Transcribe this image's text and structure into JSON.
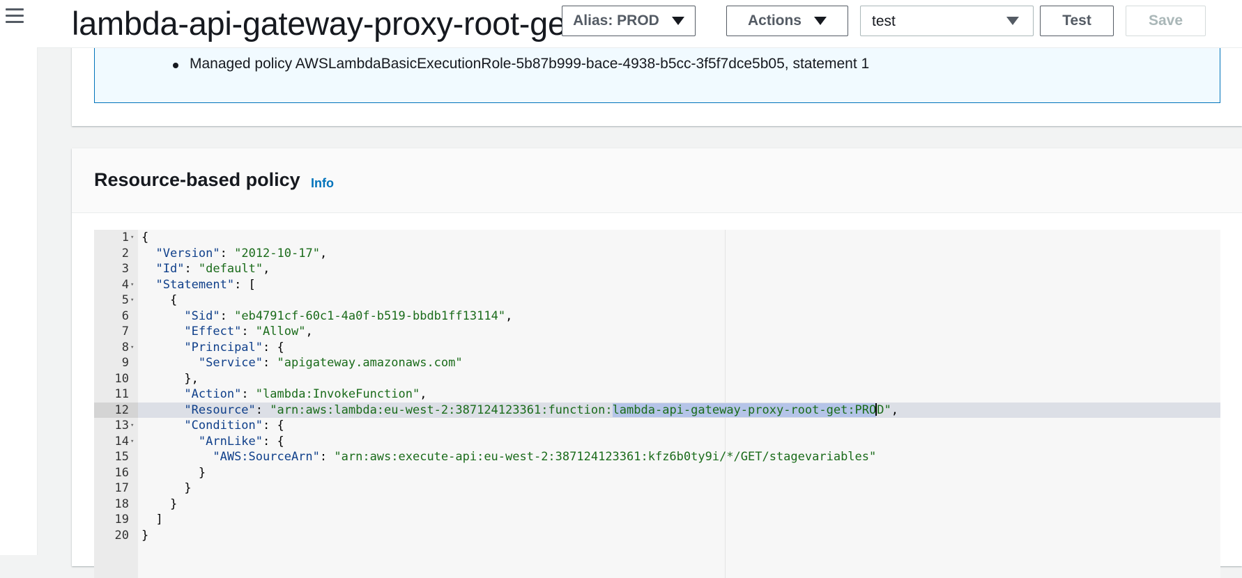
{
  "header": {
    "title": "lambda-api-gateway-proxy-root-get",
    "title_display": "lambda-api-gateway-proxy-root-ge…",
    "alias_button": "Alias: PROD",
    "actions_button": "Actions",
    "test_event_select": "test",
    "test_button": "Test",
    "save_button": "Save"
  },
  "execution_role": {
    "items": [
      "Managed policy AWSLambdaBasicExecutionRole-5b87b999-bace-4938-b5cc-3f5f7dce5b05, statement 1"
    ]
  },
  "resource_policy": {
    "title": "Resource-based policy",
    "info_link": "Info",
    "active_line": 12,
    "lines": [
      "1",
      "2",
      "3",
      "4",
      "5",
      "6",
      "7",
      "8",
      "9",
      "10",
      "11",
      "12",
      "13",
      "14",
      "15",
      "16",
      "17",
      "18",
      "19",
      "20"
    ],
    "json": {
      "Version": "2012-10-17",
      "Id": "default",
      "Sid": "eb4791cf-60c1-4a0f-b519-bbdb1ff13114",
      "Effect": "Allow",
      "Service": "apigateway.amazonaws.com",
      "Action": "lambda:InvokeFunction",
      "Resource_prefix": "arn:aws:lambda:eu-west-2:387124123361:function:",
      "Resource_selected": "lambda-api-gateway-proxy-root-get:PRO",
      "Resource_suffix": "D",
      "SourceArn": "arn:aws:execute-api:eu-west-2:387124123361:kfz6b0ty9i/*/GET/stagevariables"
    }
  },
  "colors": {
    "accent": "#0073bb",
    "info_bg": "#f1faff",
    "string": "#1a6b1a",
    "key": "#0f3f8a",
    "selection": "#b5c4e8"
  }
}
